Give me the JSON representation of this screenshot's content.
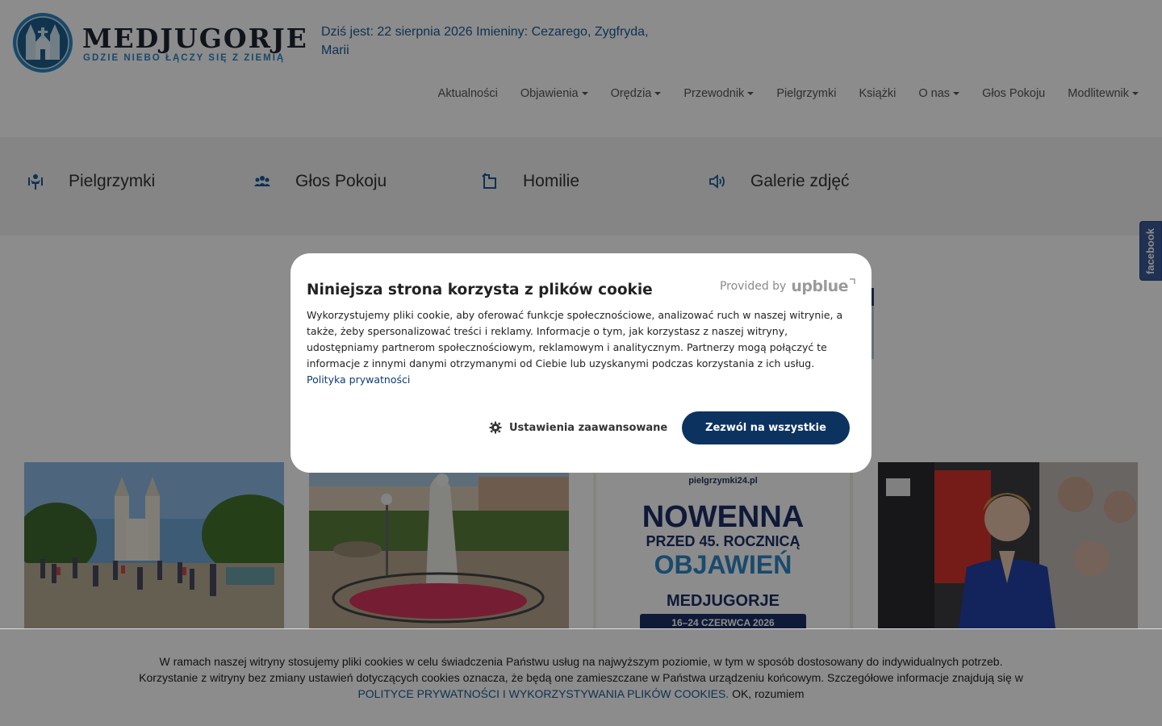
{
  "header": {
    "logo_title": "MEDJUGORJE",
    "logo_subtitle": "GDZIE NIEBO ŁĄCZY SIĘ Z ZIEMIĄ",
    "today": "Dziś jest: 22 sierpnia 2026 Imieniny: Cezarego, Zygfryda, Marii"
  },
  "nav": [
    {
      "label": "Aktualności",
      "dropdown": false
    },
    {
      "label": "Objawienia",
      "dropdown": true
    },
    {
      "label": "Orędzia",
      "dropdown": true
    },
    {
      "label": "Przewodnik",
      "dropdown": true
    },
    {
      "label": "Pielgrzymki",
      "dropdown": false
    },
    {
      "label": "Książki",
      "dropdown": false
    },
    {
      "label": "O nas",
      "dropdown": true
    },
    {
      "label": "Głos Pokoju",
      "dropdown": false
    },
    {
      "label": "Modlitewnik",
      "dropdown": true
    }
  ],
  "quickbar": [
    {
      "label": "Pielgrzymki",
      "icon": "pilgrim-icon"
    },
    {
      "label": "Głos Pokoju",
      "icon": "people-icon"
    },
    {
      "label": "Homilie",
      "icon": "book-icon"
    },
    {
      "label": "Galerie zdjęć",
      "icon": "speaker-icon"
    }
  ],
  "facebook_tab": "facebook",
  "cards": [
    {
      "image": "church-crowd"
    },
    {
      "image": "virgin-mary-statue"
    },
    {
      "image": "nowenna-poster",
      "poster": {
        "site": "pielgrzymki24.pl",
        "line1": "NOWENNA",
        "line2": "PRZED 45. ROCZNICĄ",
        "line3": "OBJAWIEŃ",
        "line4": "MEDJUGORJE",
        "line5": "16–24 CZERWCA 2026"
      }
    },
    {
      "image": "praying-woman"
    }
  ],
  "cookie_modal": {
    "title": "Niniejsza strona korzysta z plików cookie",
    "provided_by": "Provided by",
    "brand": "upblue",
    "text": "Wykorzystujemy pliki cookie, aby oferować funkcje społecznościowe, analizować ruch w naszej witrynie, a także, żeby spersonalizować treści i reklamy. Informacje o tym, jak korzystasz z naszej witryny, udostępniamy partnerom społecznościowym, reklamowym i analitycznym. Partnerzy mogą połączyć te informacje z innymi danymi otrzymanymi od Ciebie lub uzyskanymi podczas korzystania z ich usług.",
    "privacy_link": "Polityka prywatności",
    "settings_button": "Ustawienia zaawansowane",
    "allow_button": "Zezwól na wszystkie"
  },
  "cookie_bar": {
    "text": "W ramach naszej witryny stosujemy pliki cookies w celu świadczenia Państwu usług na najwyższym poziomie, w tym w sposób dostosowany do indywidualnych potrzeb. Korzystanie z witryny bez zmiany ustawień dotyczących cookies oznacza, że będą one zamieszczane w Państwa urządzeniu końcowym. Szczegółowe informacje znajdują się w",
    "policy_link": "POLITYCE PRYWATNOŚCI I WYKORZYSTYWANIA PLIKÓW COOKIES.",
    "ok_link": "OK, rozumiem"
  },
  "colors": {
    "brand_blue": "#1a5a96",
    "modal_button": "#0c3360",
    "facebook": "#3b5998"
  }
}
